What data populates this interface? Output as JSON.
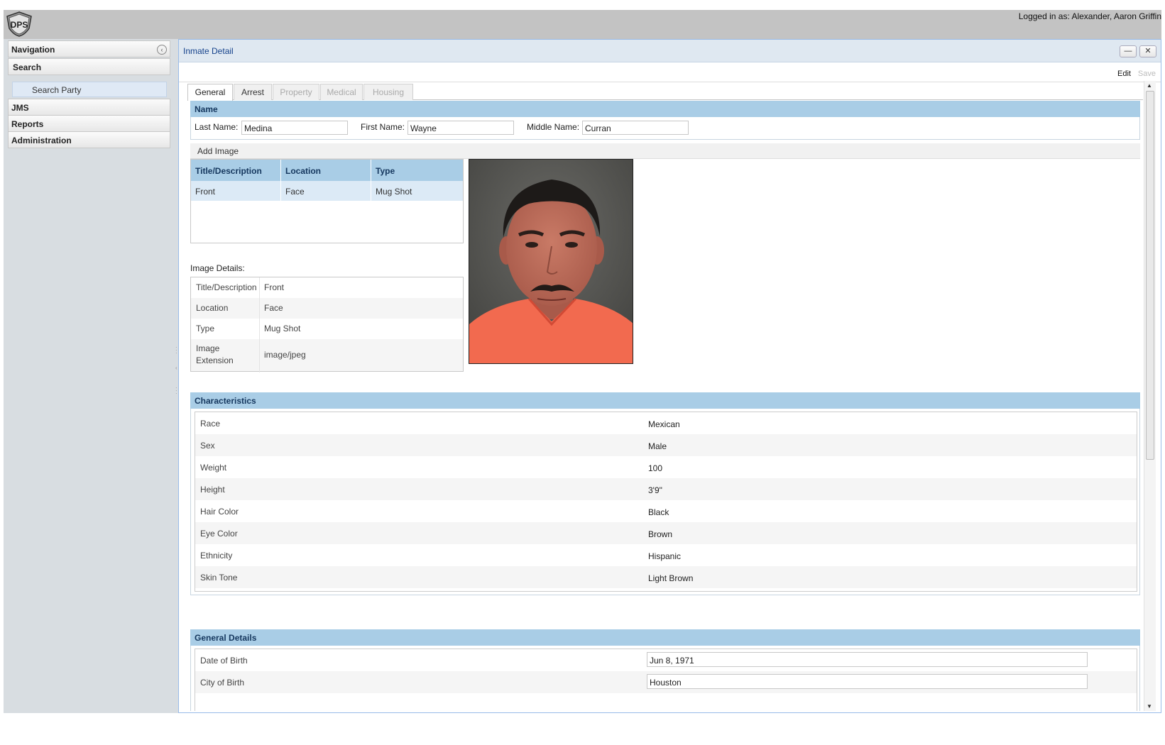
{
  "header": {
    "logo_text": "DPS",
    "login": "Logged in as: Alexander, Aaron Griffin"
  },
  "nav": {
    "title": "Navigation",
    "search": "Search",
    "search_party": "Search Party",
    "jms": "JMS",
    "reports": "Reports",
    "administration": "Administration"
  },
  "panel": {
    "title": "Inmate Detail",
    "minimize": "—",
    "close": "✕",
    "edit": "Edit",
    "save": "Save"
  },
  "tabs": [
    {
      "label": "General"
    },
    {
      "label": "Arrest"
    },
    {
      "label": "Property"
    },
    {
      "label": "Medical"
    },
    {
      "label": "Housing"
    }
  ],
  "name_section": {
    "title": "Name",
    "last_label": "Last Name:",
    "last_value": "Medina",
    "first_label": "First Name:",
    "first_value": "Wayne",
    "middle_label": "Middle Name:",
    "middle_value": "Curran"
  },
  "images": {
    "add_button": "Add Image",
    "columns": [
      "Title/Description",
      "Location",
      "Type"
    ],
    "rows": [
      [
        "Front",
        "Face",
        "Mug Shot"
      ]
    ],
    "details_label": "Image Details:",
    "details": [
      {
        "key": "Title/Description",
        "value": "Front"
      },
      {
        "key": "Location",
        "value": "Face"
      },
      {
        "key": "Type",
        "value": "Mug Shot"
      },
      {
        "key": "Image Extension",
        "value": "image/jpeg"
      }
    ]
  },
  "characteristics": {
    "title": "Characteristics",
    "rows": [
      {
        "key": "Race",
        "value": "Mexican"
      },
      {
        "key": "Sex",
        "value": "Male"
      },
      {
        "key": "Weight",
        "value": "100"
      },
      {
        "key": "Height",
        "value": "3'9\""
      },
      {
        "key": "Hair Color",
        "value": "Black"
      },
      {
        "key": "Eye Color",
        "value": "Brown"
      },
      {
        "key": "Ethnicity",
        "value": "Hispanic"
      },
      {
        "key": "Skin Tone",
        "value": "Light Brown"
      }
    ]
  },
  "general_details": {
    "title": "General Details",
    "rows": [
      {
        "key": "Date of Birth",
        "value": "Jun 8, 1971"
      },
      {
        "key": "City of Birth",
        "value": "Houston"
      }
    ]
  },
  "colors": {
    "section_header": "#a9cde6",
    "panel_border": "#99bbe8",
    "orange_jumpsuit": "#f26a4f"
  }
}
